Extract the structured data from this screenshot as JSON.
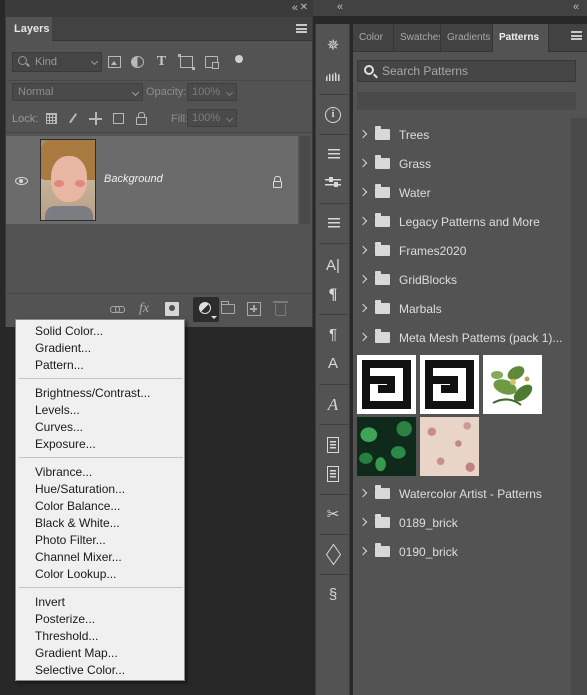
{
  "layers_panel": {
    "title": "Layers",
    "filter_kind": "Kind",
    "blend_mode": "Normal",
    "opacity_label": "Opacity:",
    "opacity_value": "100%",
    "lock_label": "Lock:",
    "fill_label": "Fill:",
    "fill_value": "100%",
    "layer": {
      "name": "Background",
      "visible": true,
      "locked": true
    }
  },
  "adjustment_menu": {
    "groups": [
      [
        "Solid Color...",
        "Gradient...",
        "Pattern..."
      ],
      [
        "Brightness/Contrast...",
        "Levels...",
        "Curves...",
        "Exposure..."
      ],
      [
        "Vibrance...",
        "Hue/Saturation...",
        "Color Balance...",
        "Black & White...",
        "Photo Filter...",
        "Channel Mixer...",
        "Color Lookup..."
      ],
      [
        "Invert",
        "Posterize...",
        "Threshold...",
        "Gradient Map...",
        "Selective Color..."
      ]
    ]
  },
  "toolbar": {
    "icons": [
      "navigator-icon",
      "histogram-icon",
      "info-icon",
      "properties-icon",
      "adjustments-icon",
      "libraries-icon",
      "character-icon",
      "paragraph-icon",
      "character-styles-icon",
      "paragraph-styles-icon",
      "glyphs-icon",
      "notes-icon",
      "document-icon",
      "tool-presets-icon",
      "3d-icon",
      "history-icon"
    ]
  },
  "patterns_panel": {
    "tabs": [
      "Color",
      "Swatches",
      "Gradients",
      "Patterns"
    ],
    "active_tab": "Patterns",
    "search_placeholder": "Search Patterns",
    "groups_top": [
      "Trees",
      "Grass",
      "Water",
      "Legacy Patterns and More",
      "Frames2020",
      "GridBlocks",
      "Marbals",
      "Meta Mesh Pattems (pack 1)..."
    ],
    "open_group": "Meta Mesh Pattems (pack 1)...",
    "swatches": [
      "greek-key-pattern",
      "greek-key-pattern",
      "flowers-pattern",
      "ivy-pattern",
      "pink-floral-pattern"
    ],
    "groups_bottom": [
      "Watercolor Artist - Patterns",
      "0189_brick",
      "0190_brick"
    ]
  },
  "colors": {
    "panel_bg": "#535353",
    "app_bg": "#282828",
    "menu_bg": "#f0f0f0",
    "selected_layer": "#6b6b6b"
  }
}
